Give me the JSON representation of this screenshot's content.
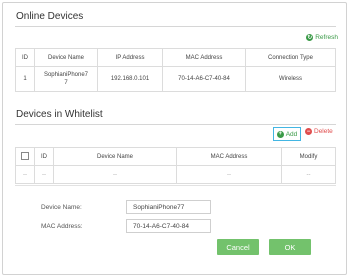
{
  "online": {
    "title": "Online Devices",
    "refresh_label": "Refresh",
    "columns": [
      "ID",
      "Device Name",
      "IP Address",
      "MAC Address",
      "Connection Type"
    ],
    "rows": [
      [
        "1",
        "SophianiPhone7\n7",
        "192.168.0.101",
        "70-14-A6-C7-40-84",
        "Wireless"
      ]
    ]
  },
  "whitelist": {
    "title": "Devices in Whitelist",
    "add_label": "Add",
    "delete_label": "Delete",
    "columns": [
      "",
      "ID",
      "Device Name",
      "MAC Address",
      "Modify"
    ],
    "placeholder_row": [
      "--",
      "--",
      "--",
      "--",
      "--"
    ],
    "edit": {
      "device_name_label": "Device Name:",
      "device_name_value": "SophianiPhone77",
      "mac_label": "MAC Address:",
      "mac_value": "70-14-A6-C7-40-84",
      "cancel_label": "Cancel",
      "ok_label": "OK"
    }
  },
  "colors": {
    "accent_green": "#73c26c",
    "add_green": "#3a9a47",
    "delete_red": "#e04d4d",
    "add_border": "#43b6e3"
  },
  "icons": {
    "refresh": "refresh-icon",
    "add": "plus-circle-icon",
    "delete": "minus-circle-icon"
  }
}
